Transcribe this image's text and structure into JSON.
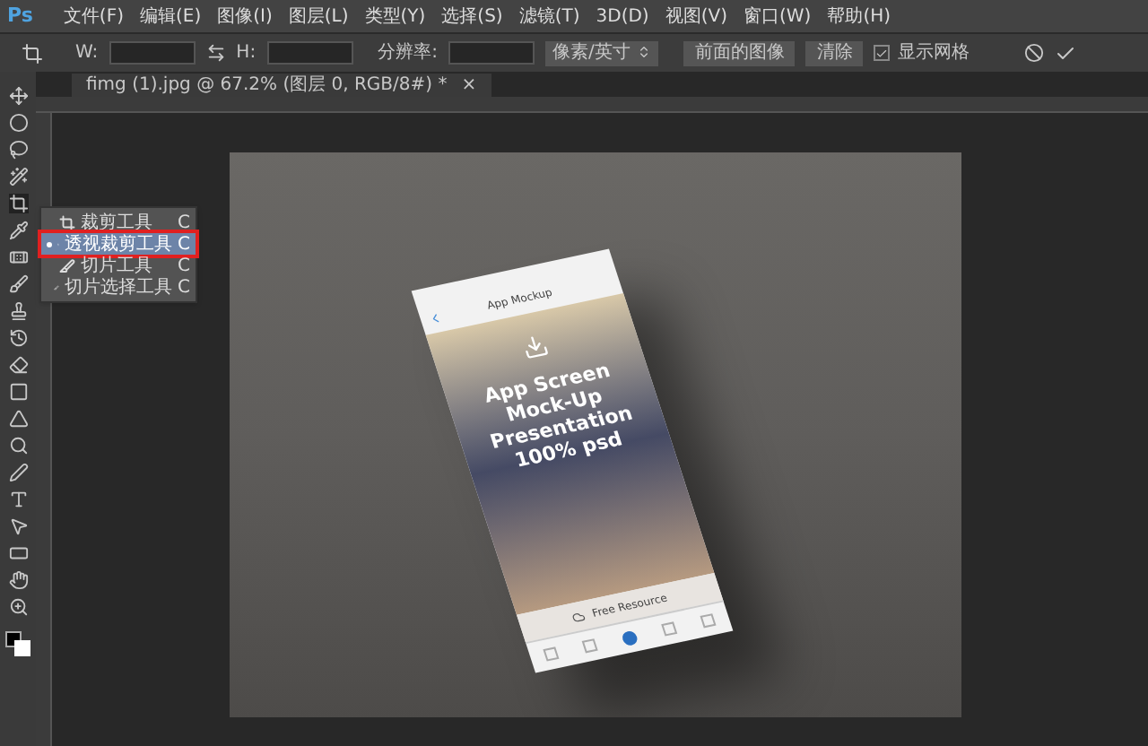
{
  "app_logo": "Ps",
  "menu_bar": [
    "文件(F)",
    "编辑(E)",
    "图像(I)",
    "图层(L)",
    "类型(Y)",
    "选择(S)",
    "滤镜(T)",
    "3D(D)",
    "视图(V)",
    "窗口(W)",
    "帮助(H)"
  ],
  "options_bar": {
    "width_label": "W:",
    "height_label": "H:",
    "resolution_label": "分辨率:",
    "unit": "像素/英寸",
    "front_image_button": "前面的图像",
    "clear_button": "清除",
    "show_grid": {
      "label": "显示网格",
      "checked": true
    }
  },
  "document_tab": {
    "title": "fimg (1).jpg @ 67.2% (图层 0, RGB/8#) *",
    "close": "×"
  },
  "tool_flyout": [
    {
      "label": "裁剪工具",
      "shortcut": "C",
      "selected": false,
      "kind": "crop"
    },
    {
      "label": "透视裁剪工具",
      "shortcut": "C",
      "selected": true,
      "kind": "perspective"
    },
    {
      "label": "切片工具",
      "shortcut": "C",
      "selected": false,
      "kind": "slice"
    },
    {
      "label": "切片选择工具",
      "shortcut": "C",
      "selected": false,
      "kind": "slice-select"
    }
  ],
  "phone_mockup": {
    "nav_title": "App Mockup",
    "headline": [
      "App Screen",
      "Mock-Up",
      "Presentation",
      "100% psd"
    ],
    "footer_label": "Free Resource"
  }
}
